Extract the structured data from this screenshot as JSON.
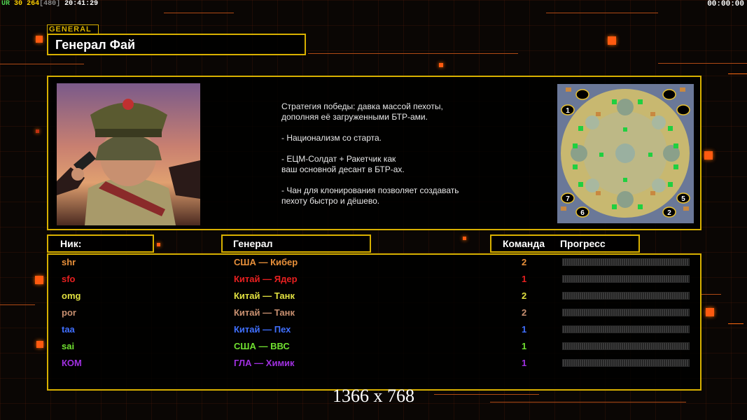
{
  "topbar": {
    "ur": "UR",
    "fps": "30",
    "value": "264",
    "bracket": "[480]",
    "clock": "20:41:29"
  },
  "timer": "00:00:00",
  "general_tag": "GENERAL",
  "general_name": "Генерал Фай",
  "description": "Стратегия победы: давка массой пехоты,\n дополняя её загруженными БТР-ами.\n\n- Национализм со старта.\n\n- ЕЦМ-Солдат + Ракетчик как\nваш основной десант в БТР-ах.\n\n- Чан для клонирования позволяет создавать\n пехоту быстро и дёшево.",
  "headers": {
    "nick": "Ник:",
    "general": "Генерал",
    "team": "Команда",
    "progress": "Прогресс"
  },
  "players": [
    {
      "nick": "shr",
      "general": "США — Кибер",
      "team": "2",
      "color": "#e8903a",
      "progress": 0
    },
    {
      "nick": "sfo",
      "general": "Китай — Ядер",
      "team": "1",
      "color": "#e82020",
      "progress": 0
    },
    {
      "nick": "omg",
      "general": "Китай — Танк",
      "team": "2",
      "color": "#e0e040",
      "progress": 0
    },
    {
      "nick": "por",
      "general": "Китай — Танк",
      "team": "2",
      "color": "#c89070",
      "progress": 0
    },
    {
      "nick": "taa",
      "general": "Китай — Пех",
      "team": "1",
      "color": "#4070ff",
      "progress": 0
    },
    {
      "nick": "sai",
      "general": "США — ВВС",
      "team": "1",
      "color": "#70e030",
      "progress": 0
    },
    {
      "nick": "КОМ",
      "general": "ГЛА — Химик",
      "team": "1",
      "color": "#a030e0",
      "progress": 0
    }
  ],
  "minimap_labels": [
    "1",
    "5",
    "6",
    "7",
    "2"
  ],
  "resolution_overlay": "1366 x 768",
  "colors": {
    "frame": "#d8b000",
    "accent": "#ff5a10"
  }
}
